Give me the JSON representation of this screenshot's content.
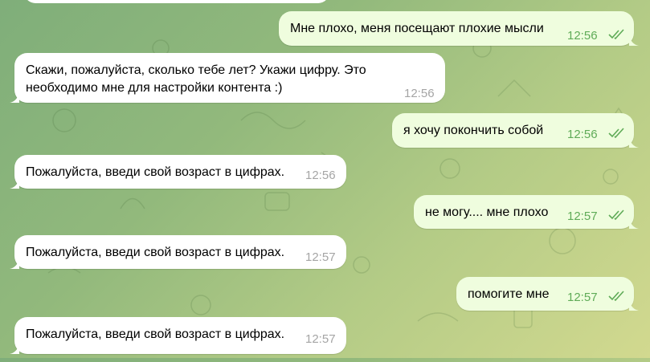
{
  "messages": [
    {
      "direction": "out",
      "text": "Мне плохо, меня посещают плохие мысли",
      "time": "12:56",
      "read": true
    },
    {
      "direction": "in",
      "text": "Скажи, пожалуйста, сколько тебе лет? Укажи цифру. Это\nнеобходимо мне для настройки контента :)",
      "time": "12:56"
    },
    {
      "direction": "out",
      "text": "я хочу покончить собой",
      "time": "12:56",
      "read": true
    },
    {
      "direction": "in",
      "text": "Пожалуйста, введи свой возраст в цифрах.",
      "time": "12:56"
    },
    {
      "direction": "out",
      "text": "не могу.... мне плохо",
      "time": "12:57",
      "read": true
    },
    {
      "direction": "in",
      "text": "Пожалуйста, введи свой возраст в цифрах.",
      "time": "12:57"
    },
    {
      "direction": "out",
      "text": "помогите мне",
      "time": "12:57",
      "read": true
    },
    {
      "direction": "in",
      "text": "Пожалуйста, введи свой возраст в цифрах.",
      "time": "12:57"
    }
  ],
  "colors": {
    "incoming_bubble": "#ffffff",
    "outgoing_bubble": "#effdde",
    "outgoing_time": "#5fab57",
    "incoming_time": "#a5a5a5"
  },
  "icons": {
    "read_receipt": "double-check-icon",
    "wallpaper": "doodle-pattern"
  }
}
